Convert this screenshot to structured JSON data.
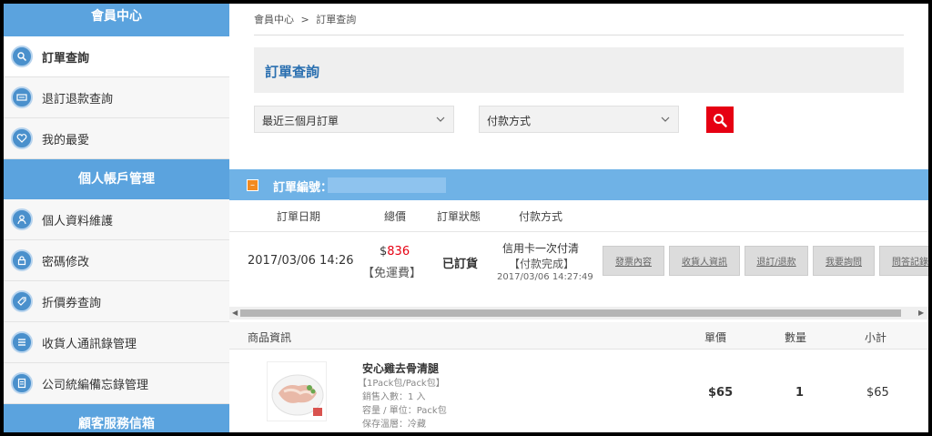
{
  "sidebar": {
    "header_member": "會員中心",
    "header_account": "個人帳戶管理",
    "header_service": "顧客服務信箱",
    "items": [
      {
        "label": "訂單查詢",
        "icon": "search-icon"
      },
      {
        "label": "退訂退款查詢",
        "icon": "refund-icon"
      },
      {
        "label": "我的最愛",
        "icon": "heart-icon"
      },
      {
        "label": "個人資料維護",
        "icon": "user-icon"
      },
      {
        "label": "密碼修改",
        "icon": "lock-icon"
      },
      {
        "label": "折價券查詢",
        "icon": "coupon-icon"
      },
      {
        "label": "收貨人通訊錄管理",
        "icon": "list-icon"
      },
      {
        "label": "公司統編備忘錄管理",
        "icon": "document-icon"
      }
    ]
  },
  "breadcrumb": {
    "home": "會員中心",
    "separator": ">",
    "current": "訂單查詢"
  },
  "page_title": "訂單查詢",
  "filters": {
    "period": "最近三個月訂單",
    "payment": "付款方式"
  },
  "order": {
    "label": "訂單編號：",
    "headers": {
      "date": "訂單日期",
      "total": "總價",
      "status": "訂單狀態",
      "payment": "付款方式"
    },
    "date": "2017/03/06 14:26",
    "total_symbol": "$",
    "total_value": "836",
    "shipping": "【免運費】",
    "status": "已訂貨",
    "payment_method": "信用卡一次付清",
    "payment_status": "【付款完成】",
    "payment_time": "2017/03/06 14:27:49",
    "actions": [
      "發票內容",
      "收貨人資訊",
      "退訂/退款",
      "我要詢問",
      "問答記錄"
    ]
  },
  "products": {
    "headers": {
      "info": "商品資訊",
      "unit_price": "單價",
      "quantity": "數量",
      "subtotal": "小計"
    },
    "items": [
      {
        "name": "安心雞去骨清腿",
        "spec": "【1Pack包/Pack包】",
        "servings": "銷售入數：1 入",
        "capacity": "容量 / 單位：Pack包",
        "storage": "保存溫層：冷藏",
        "unit_price": "$65",
        "quantity": "1",
        "subtotal": "$65"
      }
    ]
  },
  "colors": {
    "accent": "#5ba3de",
    "price_red": "#e60012",
    "search_button": "#e60012"
  }
}
